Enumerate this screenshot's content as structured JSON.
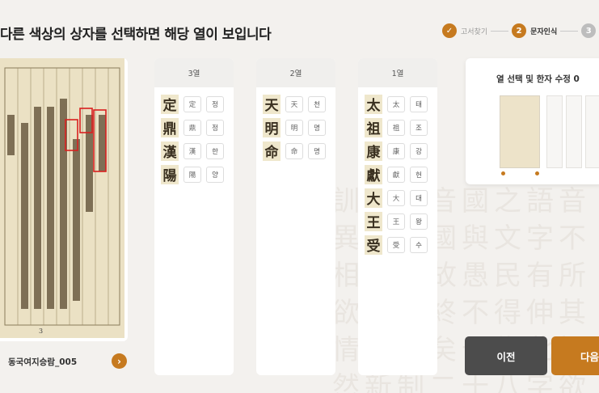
{
  "header": {
    "instruction": "다른 색상의 상자를 선택하면 해당 열이 보입니다"
  },
  "stepper": {
    "steps": [
      {
        "number": "✓",
        "label": "고서찾기",
        "state": "done"
      },
      {
        "number": "2",
        "label": "문자인식",
        "state": "active"
      },
      {
        "number": "3",
        "label": "",
        "state": "todo"
      }
    ]
  },
  "document": {
    "name": "동국여지승람_005",
    "page_number": "3",
    "arrow": "›"
  },
  "columns": [
    {
      "title": "3열",
      "rows": [
        {
          "glyph": "定",
          "hanja": "定",
          "reading": "정"
        },
        {
          "glyph": "鼎",
          "hanja": "鼎",
          "reading": "정"
        },
        {
          "glyph": "漢",
          "hanja": "漢",
          "reading": "한"
        },
        {
          "glyph": "陽",
          "hanja": "陽",
          "reading": "양"
        }
      ]
    },
    {
      "title": "2열",
      "rows": [
        {
          "glyph": "天",
          "hanja": "天",
          "reading": "천"
        },
        {
          "glyph": "明",
          "hanja": "明",
          "reading": "명"
        },
        {
          "glyph": "命",
          "hanja": "命",
          "reading": "명"
        }
      ]
    },
    {
      "title": "1열",
      "rows": [
        {
          "glyph": "太",
          "hanja": "太",
          "reading": "태"
        },
        {
          "glyph": "祖",
          "hanja": "祖",
          "reading": "조"
        },
        {
          "glyph": "康",
          "hanja": "康",
          "reading": "강"
        },
        {
          "glyph": "獻",
          "hanja": "獻",
          "reading": "헌"
        },
        {
          "glyph": "大",
          "hanja": "大",
          "reading": "대"
        },
        {
          "glyph": "王",
          "hanja": "王",
          "reading": "왕"
        },
        {
          "glyph": "受",
          "hanja": "受",
          "reading": "수"
        }
      ]
    }
  ],
  "preview": {
    "title": "열 선택 및 한자 수정 0"
  },
  "buttons": {
    "prev_label": "이전",
    "next_label": "다음"
  },
  "colors": {
    "accent": "#c67a1f",
    "dark_button": "#4c4c4c",
    "highlight_box": "#d92020"
  }
}
